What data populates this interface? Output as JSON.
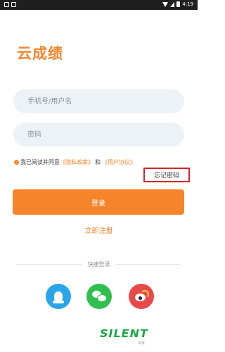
{
  "status_bar": {
    "time": "4:19"
  },
  "app": {
    "title": "云成绩"
  },
  "form": {
    "username_placeholder": "手机号/用户名",
    "password_placeholder": "密码"
  },
  "agreement": {
    "prefix": "我已阅读并同意",
    "privacy_link": "《隐私政策》",
    "and": "和",
    "terms_link": "《用户协议》"
  },
  "forgot_password": "忘记密码",
  "login_button": "登录",
  "register_link": "立即注册",
  "quick_login": {
    "label": "快捷登录",
    "options": [
      "qq-icon",
      "wechat-icon",
      "weibo-icon"
    ]
  },
  "watermark": {
    "text": "SILENT",
    "sub": "百家"
  },
  "colors": {
    "accent": "#f5842b",
    "field_bg": "#edf2f6",
    "highlight": "#d8232a"
  }
}
